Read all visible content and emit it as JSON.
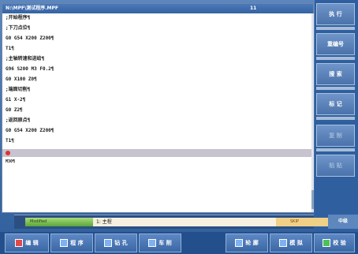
{
  "window": {
    "title": "N:\\MPF\\测试程序.MPF",
    "line_number": "11"
  },
  "editor": {
    "lines": [
      ";开始程序¶",
      ";下刀点位¶",
      "G0 G54 X200 Z200¶",
      "T1¶",
      ";主轴转速和进给¶",
      "G96 S200 M3 F0.2¶",
      "G0 X100 Z0¶",
      ";端面切削¶",
      "G1 X-2¶",
      "G0 Z2¶",
      ";返回原点¶",
      "G0 G54 X200 Z200¶",
      "T1¶"
    ],
    "selected_line": "",
    "after_line": "M30¶"
  },
  "side_softkeys": [
    "执 行",
    "重编号",
    "搜 索",
    "标 记",
    "复 制",
    "粘 贴"
  ],
  "status": {
    "green_label": "Modified",
    "message": "1: 主程",
    "orange_label": "SKIP",
    "right_label": "中级"
  },
  "bottom_softkeys": [
    "编 辑",
    "程 序",
    "钻 孔",
    "车 削",
    "轮 廓",
    "模 拟",
    "校 验"
  ]
}
